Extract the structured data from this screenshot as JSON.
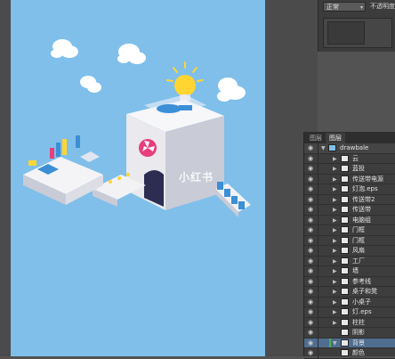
{
  "properties_panel": {
    "blend_mode": "正常",
    "opacity_label": "不透明度"
  },
  "layers_panel": {
    "tabs": [
      {
        "label": "图层",
        "active": false
      },
      {
        "label": "图层",
        "active": true
      }
    ],
    "root_group": "drawbale",
    "layers": [
      {
        "name": "云",
        "type": "group",
        "selected": false
      },
      {
        "name": "蓝投",
        "type": "group",
        "selected": false
      },
      {
        "name": "传送带电源",
        "type": "group",
        "selected": false
      },
      {
        "name": "灯泡.eps",
        "type": "group",
        "selected": false
      },
      {
        "name": "传送带2",
        "type": "group",
        "selected": false
      },
      {
        "name": "传送带",
        "type": "group",
        "selected": false
      },
      {
        "name": "电脑组",
        "type": "group",
        "selected": false
      },
      {
        "name": "门框",
        "type": "group",
        "selected": false
      },
      {
        "name": "门框",
        "type": "group",
        "selected": false
      },
      {
        "name": "风扇",
        "type": "group",
        "selected": false
      },
      {
        "name": "工厂",
        "type": "group",
        "selected": false
      },
      {
        "name": "墙",
        "type": "group",
        "selected": false
      },
      {
        "name": "参考线",
        "type": "group",
        "selected": false
      },
      {
        "name": "桌子和凳",
        "type": "group",
        "selected": false
      },
      {
        "name": "小桌子",
        "type": "group",
        "selected": false
      },
      {
        "name": "灯.eps",
        "type": "group",
        "selected": false
      },
      {
        "name": "柱柱",
        "type": "group",
        "selected": false
      },
      {
        "name": "阴影",
        "type": "layer",
        "selected": false
      },
      {
        "name": "背景",
        "type": "group",
        "selected": true
      },
      {
        "name": "颜色",
        "type": "layer",
        "selected": false
      }
    ]
  },
  "artboard": {
    "watermark": "小红书",
    "colors": {
      "background": "#7fbfea",
      "cloud": "#ffffff",
      "building": "#f2f2f4",
      "building_shade": "#c9cbd6",
      "accent_pink": "#e83e7c",
      "bulb": "#ffd531",
      "screen_blue": "#3b8fd6"
    }
  }
}
